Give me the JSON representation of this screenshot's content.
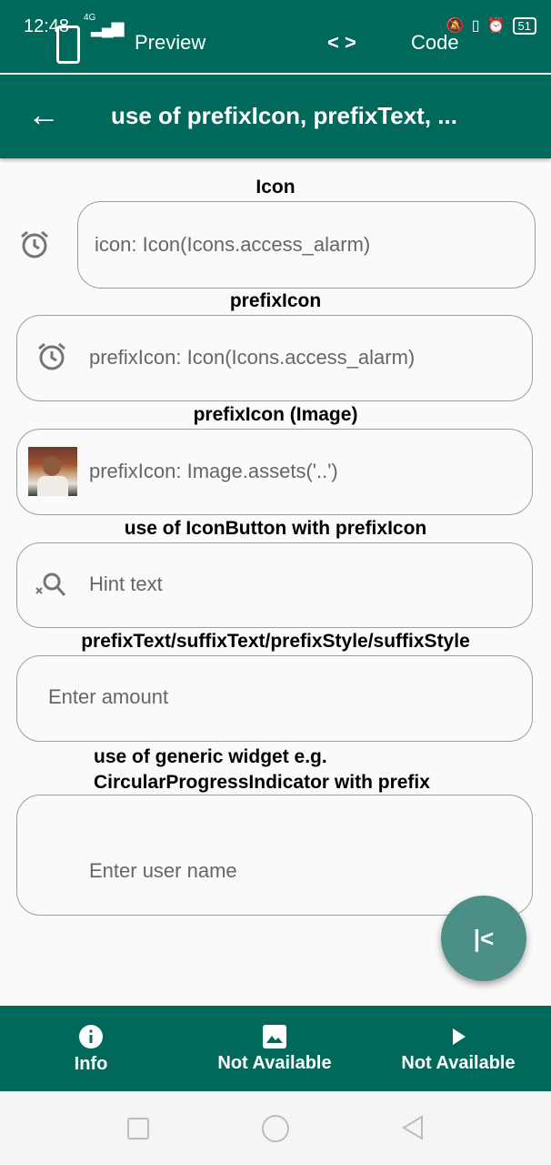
{
  "status": {
    "time": "12:48",
    "network": "4G",
    "battery": "51"
  },
  "top_tabs": {
    "preview": "Preview",
    "code_symbol": "< >",
    "code": "Code"
  },
  "appbar": {
    "title": "use of prefixIcon, prefixText, ..."
  },
  "sections": [
    {
      "label": "Icon",
      "text": "icon: Icon(Icons.access_alarm)"
    },
    {
      "label": "prefixIcon",
      "text": "prefixIcon: Icon(Icons.access_alarm)"
    },
    {
      "label": "prefixIcon (Image)",
      "text": "prefixIcon: Image.assets('..')"
    },
    {
      "label": "use of IconButton with prefixIcon",
      "text": "Hint text"
    },
    {
      "label": "prefixText/suffixText/prefixStyle/suffixStyle",
      "text": "Enter amount"
    },
    {
      "label_line1": "use of generic widget e.g.",
      "label_line2": "CircularProgressIndicator with prefix",
      "text": "Enter user name"
    }
  ],
  "bottom_nav": [
    {
      "label": "Info",
      "icon": "info-icon"
    },
    {
      "label": "Not Available",
      "icon": "image-icon"
    },
    {
      "label": "Not Available",
      "icon": "play-icon"
    }
  ],
  "colors": {
    "primary": "#00695c",
    "fab": "#4b8f87",
    "border": "#9e9e9e"
  }
}
